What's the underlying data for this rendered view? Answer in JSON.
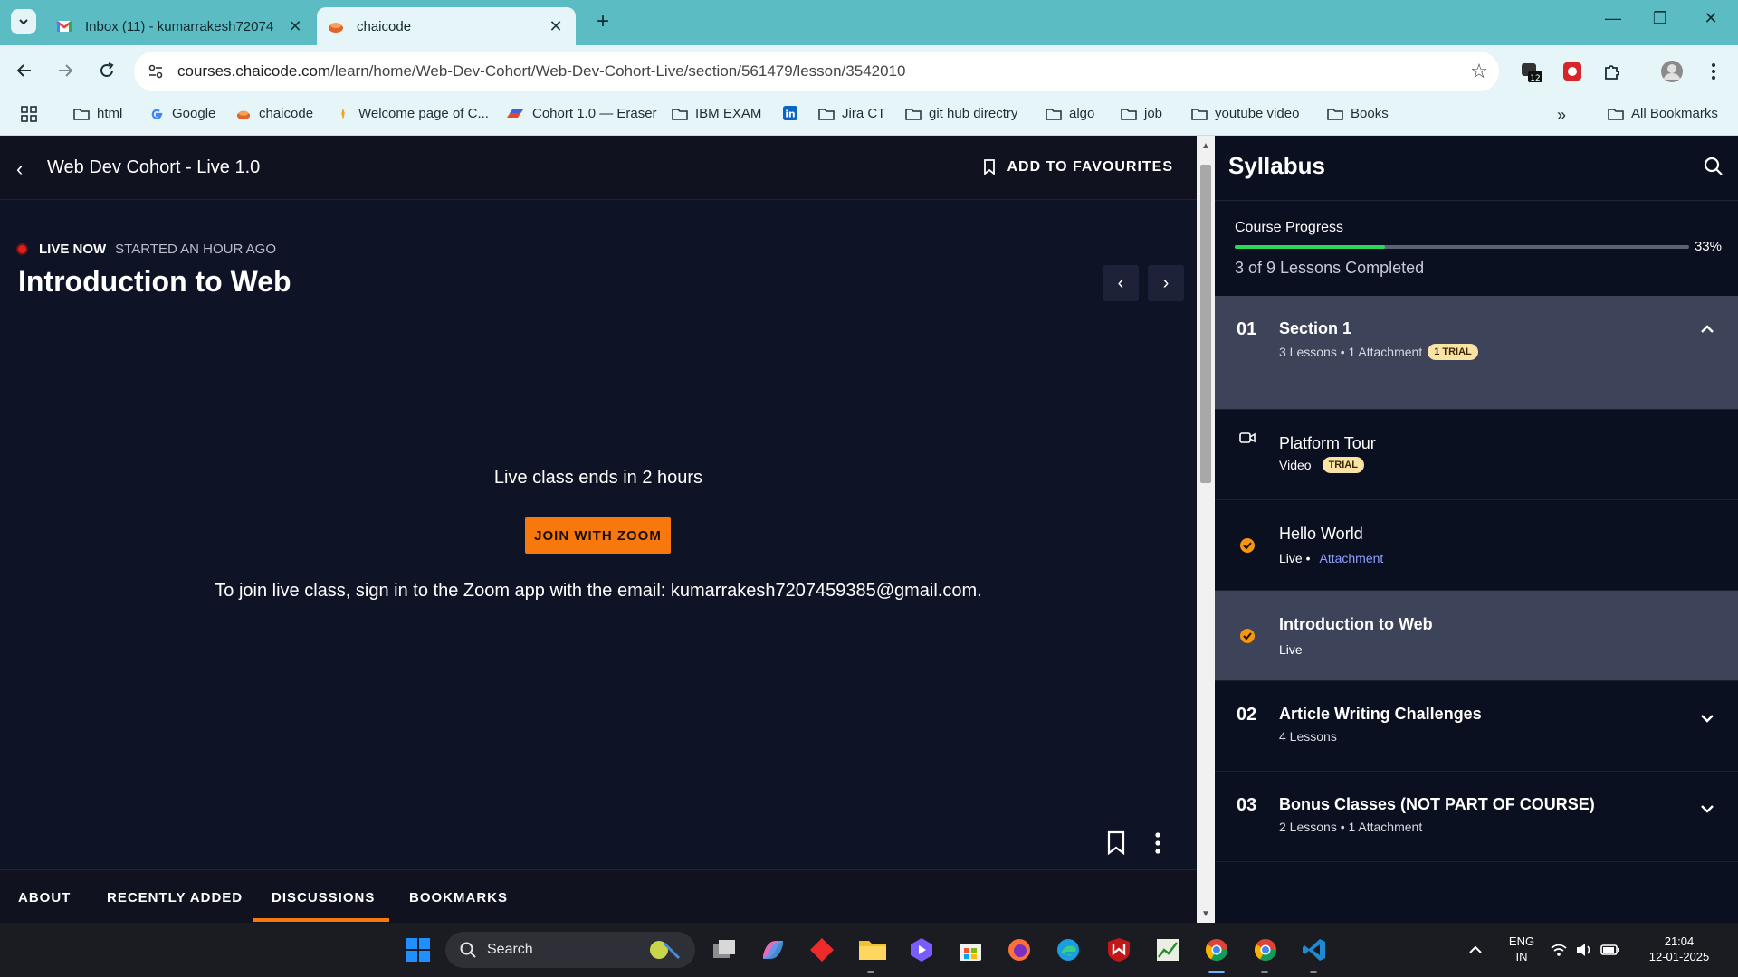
{
  "browser": {
    "tabs": [
      {
        "title": "Inbox (11) - kumarrakesh72074"
      },
      {
        "title": "chaicode"
      }
    ],
    "url_host": "courses.chaicode.com",
    "url_path": "/learn/home/Web-Dev-Cohort/Web-Dev-Cohort-Live/section/561479/lesson/3542010",
    "extension_badge": "12",
    "bookmarks": [
      {
        "label": "html",
        "icon": "folder-icon"
      },
      {
        "label": "Google",
        "icon": "google-icon"
      },
      {
        "label": "chaicode",
        "icon": "chaicode-icon"
      },
      {
        "label": "Welcome page of C...",
        "icon": "site-icon"
      },
      {
        "label": "Cohort 1.0 — Eraser",
        "icon": "eraser-icon"
      },
      {
        "label": "IBM EXAM",
        "icon": "folder-icon"
      },
      {
        "label": "",
        "icon": "linkedin-icon"
      },
      {
        "label": "Jira CT",
        "icon": "folder-icon"
      },
      {
        "label": "git hub directry",
        "icon": "folder-icon"
      },
      {
        "label": "algo",
        "icon": "folder-icon"
      },
      {
        "label": "job",
        "icon": "folder-icon"
      },
      {
        "label": "youtube video",
        "icon": "folder-icon"
      },
      {
        "label": "Books",
        "icon": "folder-icon"
      }
    ],
    "all_bookmarks": "All Bookmarks"
  },
  "page": {
    "course_title": "Web Dev Cohort - Live 1.0",
    "add_favourites": "ADD TO FAVOURITES",
    "live_now": "LIVE NOW",
    "started": "STARTED AN HOUR AGO",
    "lesson_title": "Introduction to Web",
    "ends_text": "Live class ends in 2 hours",
    "join_button": "JOIN WITH ZOOM",
    "instruction": "To join live class, sign in to the Zoom app with the email: kumarrakesh7207459385@gmail.com.",
    "tabs": [
      "ABOUT",
      "RECENTLY ADDED",
      "DISCUSSIONS",
      "BOOKMARKS"
    ],
    "active_tab": "DISCUSSIONS",
    "accent_color": "#f7780d"
  },
  "syllabus": {
    "title": "Syllabus",
    "progress_label": "Course Progress",
    "progress_percent": 33,
    "progress_text": "33%",
    "lessons_completed": "3 of 9 Lessons Completed",
    "sections": [
      {
        "num": "01",
        "title": "Section 1",
        "meta": "3 Lessons • 1 Attachment",
        "badge": "1 TRIAL"
      },
      {
        "num": "02",
        "title": "Article Writing Challenges",
        "meta": "4 Lessons"
      },
      {
        "num": "03",
        "title": "Bonus Classes (NOT PART OF COURSE)",
        "meta": "2 Lessons • 1 Attachment"
      }
    ],
    "lessons": [
      {
        "title": "Platform Tour",
        "meta": "Video",
        "badge": "TRIAL",
        "icon": "video-icon"
      },
      {
        "title": "Hello World",
        "meta": "Live •",
        "link": "Attachment",
        "icon": "check-circle-icon"
      },
      {
        "title": "Introduction to Web",
        "meta": "Live",
        "icon": "check-circle-icon"
      }
    ]
  },
  "taskbar": {
    "search": "Search",
    "lang1": "ENG",
    "lang2": "IN",
    "time": "21:04",
    "date": "12-01-2025"
  }
}
